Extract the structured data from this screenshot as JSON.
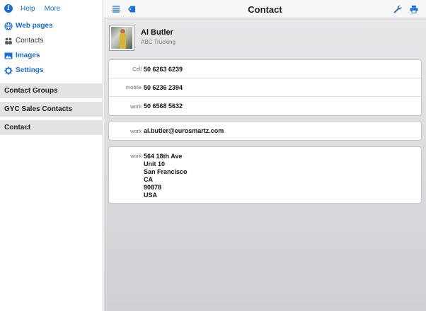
{
  "sidebar": {
    "top": {
      "info_icon": "info-icon",
      "help_label": "Help",
      "more_label": "More"
    },
    "nav": [
      {
        "label": "Web pages",
        "icon": "globe-icon"
      },
      {
        "label": "Contacts",
        "icon": "contacts-icon"
      },
      {
        "label": "Images",
        "icon": "images-icon"
      },
      {
        "label": "Settings",
        "icon": "gear-icon"
      }
    ],
    "groups": [
      "Contact Groups",
      "GYC Sales Contacts",
      "Contact"
    ]
  },
  "header": {
    "title": "Contact",
    "left_icons": [
      "list-icon",
      "tag-icon"
    ],
    "right_icons": [
      "wrench-icon",
      "printer-icon"
    ]
  },
  "contact": {
    "name": "Al Butler",
    "company": "ABC Trucking",
    "phones": [
      {
        "label": "Cell",
        "value": "50 6263 6239"
      },
      {
        "label": "mobile",
        "value": "50 6236 2394"
      },
      {
        "label": "work",
        "value": "50 6568 5632"
      }
    ],
    "email": {
      "label": "work",
      "value": "al.butler@eurosmartz.com"
    },
    "address": {
      "label": "work",
      "lines": [
        "564 18th Ave",
        "Unit 10",
        "San Francisco",
        "CA",
        "90878",
        "USA"
      ]
    }
  },
  "colors": {
    "accent": "#1a6fd8",
    "group_bar": "#e3e3e5"
  }
}
